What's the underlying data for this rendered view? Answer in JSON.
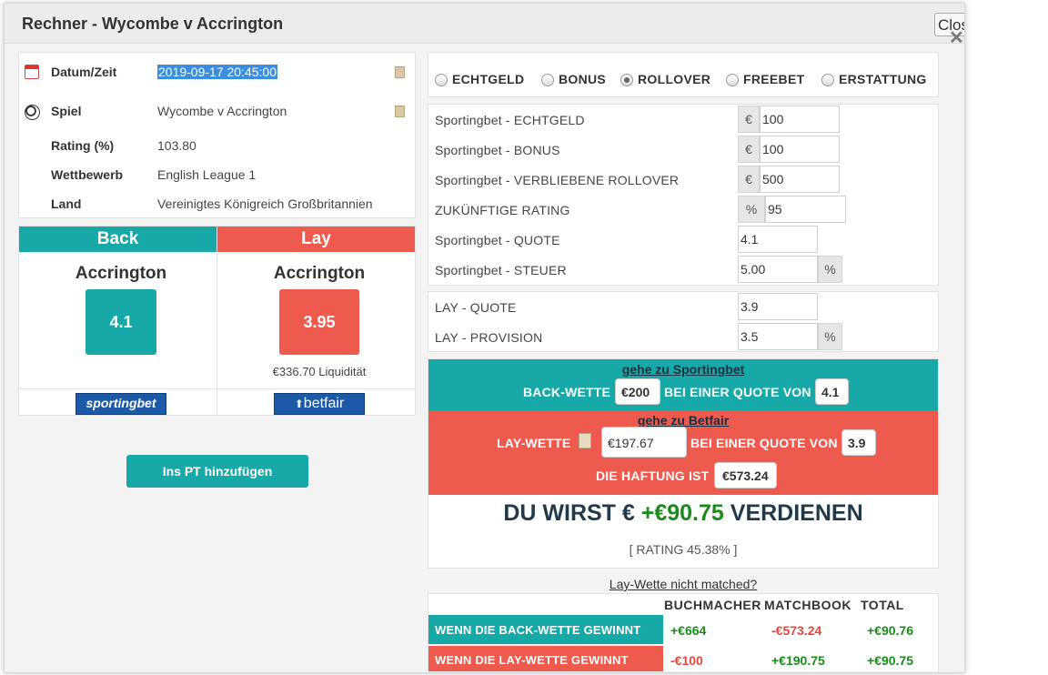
{
  "header": {
    "title": "Rechner - Wycombe v Accrington",
    "close_label": "Close"
  },
  "info": {
    "datum_label": "Datum/Zeit",
    "datum_value": "2019-09-17 20:45:00",
    "spiel_label": "Spiel",
    "spiel_value": "Wycombe v Accrington",
    "rating_label": "Rating (%)",
    "rating_value": "103.80",
    "wettbewerb_label": "Wettbewerb",
    "wettbewerb_value": "English League 1",
    "land_label": "Land",
    "land_value": "Vereinigtes Königreich Großbritannien"
  },
  "back": {
    "heading": "Back",
    "team": "Accrington",
    "odds": "4.1",
    "logo_text": "sportingbet"
  },
  "lay": {
    "heading": "Lay",
    "team": "Accrington",
    "odds": "3.95",
    "liquidity": "€336.70 Liquidität",
    "logo_text": "betfair"
  },
  "add_pt_button": "Ins PT hinzufügen",
  "modes": [
    {
      "label": "ECHTGELD",
      "selected": false
    },
    {
      "label": "BONUS",
      "selected": false
    },
    {
      "label": "ROLLOVER",
      "selected": true
    },
    {
      "label": "FREEBET",
      "selected": false
    },
    {
      "label": "ERSTATTUNG",
      "selected": false
    }
  ],
  "form": {
    "echtgeld_label": "Sportingbet - ECHTGELD",
    "echtgeld_unit": "€",
    "echtgeld_value": "100",
    "bonus_label": "Sportingbet - BONUS",
    "bonus_unit": "€",
    "bonus_value": "100",
    "rollover_label": "Sportingbet - VERBLIEBENE ROLLOVER",
    "rollover_unit": "€",
    "rollover_value": "500",
    "rating_label": "ZUKÜNFTIGE RATING",
    "rating_unit": "%",
    "rating_value": "95",
    "quote_label": "Sportingbet - QUOTE",
    "quote_value": "4.1",
    "steuer_label": "Sportingbet - STEUER",
    "steuer_value": "5.00",
    "steuer_unit": "%"
  },
  "lay_form": {
    "quote_label": "LAY - QUOTE",
    "quote_value": "3.9",
    "provision_label": "LAY - PROVISION",
    "provision_value": "3.5",
    "provision_unit": "%"
  },
  "result": {
    "goto_back": "gehe zu Sportingbet",
    "back_bet_label": "BACK-WETTE",
    "back_bet_value": "€200",
    "back_quote_text": "BEI EINER QUOTE VON",
    "back_quote_value": "4.1",
    "goto_lay": "gehe zu Betfair",
    "lay_bet_label": "LAY-WETTE",
    "lay_bet_value": "€197.67",
    "lay_quote_text": "BEI EINER QUOTE VON",
    "lay_quote_value": "3.9",
    "liability_label": "DIE HAFTUNG IST",
    "liability_value": "€573.24",
    "earn_prefix": "DU WIRST €",
    "earn_value": "+€90.75",
    "earn_suffix": "VERDIENEN",
    "rating_text": "[ RATING 45.38% ]",
    "not_matched_link": "Lay-Wette nicht matched?"
  },
  "outcome_table": {
    "headers": [
      "BUCHMACHER",
      "MATCHBOOK",
      "TOTAL"
    ],
    "rows": [
      {
        "label": "WENN DIE BACK-WETTE GEWINNT",
        "bookmaker": "+€664",
        "matchbook": "-€573.24",
        "total": "+€90.76"
      },
      {
        "label": "WENN DIE LAY-WETTE GEWINNT",
        "bookmaker": "-€100",
        "matchbook": "+€190.75",
        "total": "+€90.75"
      }
    ]
  },
  "colors": {
    "teal": "#16a9a7",
    "red": "#ef5a4e",
    "positive": "#1a8a1a",
    "negative": "#e4483c"
  }
}
